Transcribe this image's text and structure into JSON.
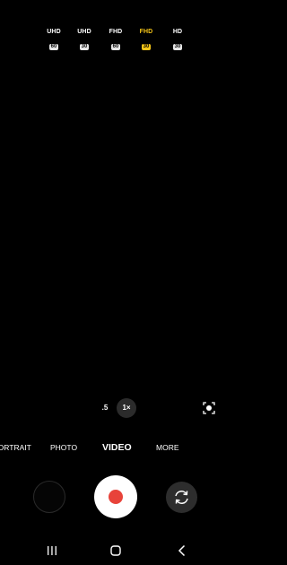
{
  "resolution_options": [
    {
      "name": "UHD",
      "fps": "60",
      "selected": false
    },
    {
      "name": "UHD",
      "fps": "30",
      "selected": false
    },
    {
      "name": "FHD",
      "fps": "60",
      "selected": false
    },
    {
      "name": "FHD",
      "fps": "30",
      "selected": true
    },
    {
      "name": "HD",
      "fps": "30",
      "selected": false
    }
  ],
  "zoom": {
    "wide_label": ".5",
    "current_label": "1×"
  },
  "modes": {
    "portrait": "PORTRAIT",
    "photo": "PHOTO",
    "video": "VIDEO",
    "more": "MORE",
    "active": "VIDEO"
  },
  "icons": {
    "scene_optimizer": "scene-optimizer-icon",
    "switch_camera": "switch-camera-icon",
    "record": "record-icon",
    "recents": "recents-icon",
    "home": "home-icon",
    "back": "back-icon"
  },
  "colors": {
    "selected_accent": "#f5c518",
    "record_red": "#e8433a",
    "background": "#000000"
  }
}
